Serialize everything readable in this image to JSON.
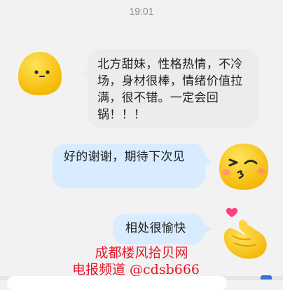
{
  "chat": {
    "timestamp": "19:01",
    "messages": [
      {
        "side": "left",
        "text": "北方甜妹，性格热情，不冷场，身材很棒，情绪价值拉满，很不错。一定会回锅！！！"
      },
      {
        "side": "right",
        "text": "好的谢谢，期待下次见"
      },
      {
        "side": "right",
        "text": "相处很愉快"
      }
    ]
  },
  "watermark": {
    "line1": "成都楼风拾贝网",
    "line2": "电报频道 @cdsb666"
  },
  "avatars": {
    "left": "yellow-blob-smile-icon",
    "right_wink": "yellow-blob-kiss-wink-icon",
    "right_heart": "finger-heart-hand-icon"
  },
  "colors": {
    "background": "#f2f2f2",
    "left_bubble": "#ececec",
    "right_bubble": "#d8ebff",
    "watermark": "#e0182b",
    "avatar_yellow": "#ffcc22"
  }
}
